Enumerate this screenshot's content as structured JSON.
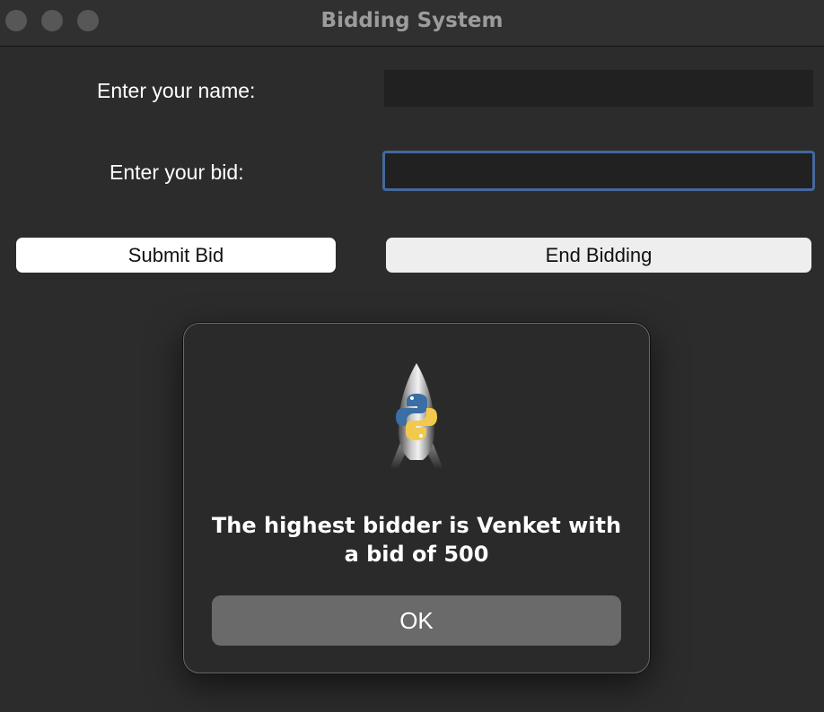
{
  "window": {
    "title": "Bidding System"
  },
  "form": {
    "name_label": "Enter your name:",
    "name_value": "",
    "bid_label": "Enter your bid:",
    "bid_value": ""
  },
  "buttons": {
    "submit_label": "Submit Bid",
    "end_label": "End Bidding"
  },
  "dialog": {
    "icon": "python-launcher-rocket-icon",
    "message": "The highest bidder is Venket with a bid of 500",
    "ok_label": "OK"
  },
  "colors": {
    "window_bg": "#2c2c2c",
    "focus_ring": "#45689c",
    "dialog_button": "#6a6a6a"
  }
}
